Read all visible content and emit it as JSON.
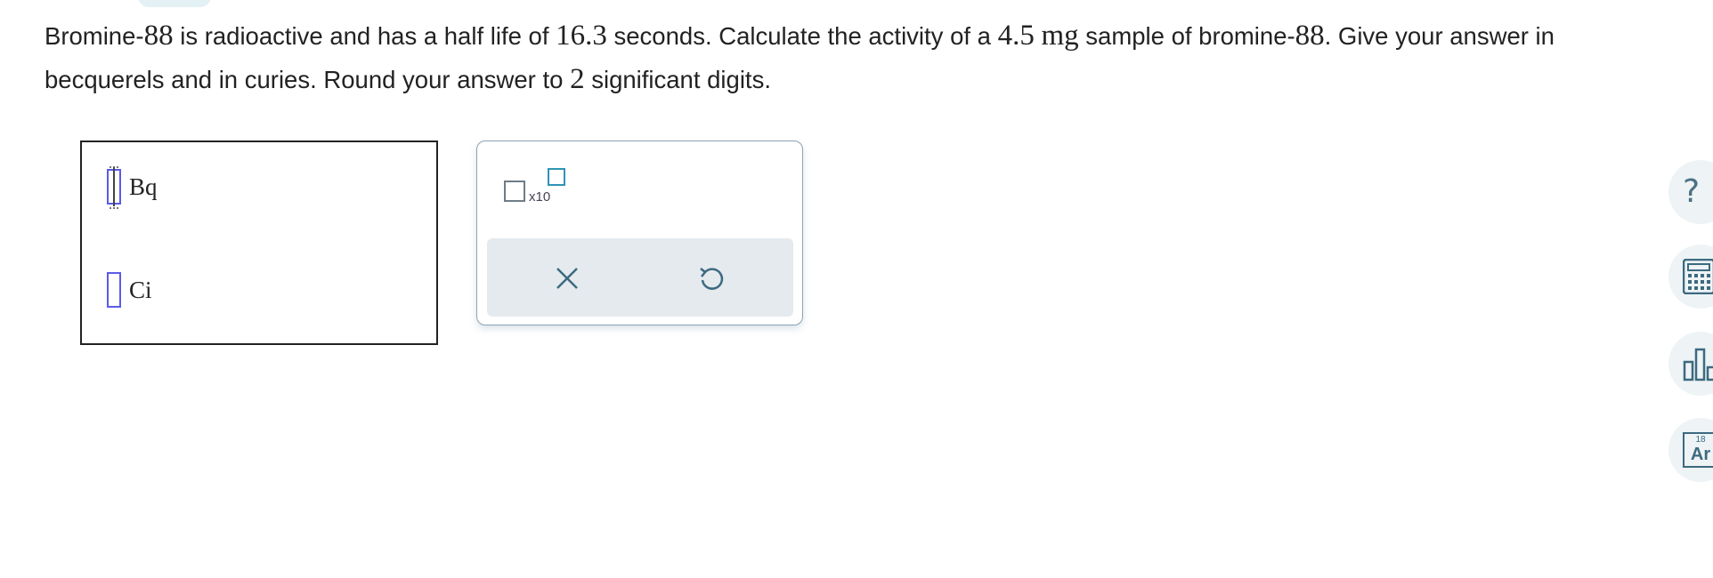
{
  "question": {
    "t1": "Bromine-",
    "m1": "88",
    "t2": " is radioactive and has a half life of ",
    "m2": "16.3",
    "t3": " seconds. Calculate the activity of a ",
    "m3": "4.5",
    "t4": " ",
    "m4": "mg",
    "t5": " sample of bromine-",
    "m5": "88",
    "t6": ". Give your answer in becquerels and in curies. Round your answer to ",
    "m6": "2",
    "t7": " significant digits."
  },
  "answer": {
    "rows": [
      {
        "unit": "Bq",
        "value": ""
      },
      {
        "unit": "Ci",
        "value": ""
      }
    ]
  },
  "tools": {
    "x10_label": "x10",
    "clear_icon": "close-icon",
    "undo_icon": "undo-icon"
  },
  "side": {
    "help_icon": "?",
    "calculator_icon": "calculator-icon",
    "chart_icon": "bar-chart-icon",
    "periodic_table": {
      "number": "18",
      "symbol": "Ar"
    }
  },
  "colors": {
    "slot_border": "#5a5be8",
    "exponent_box": "#2f93b5",
    "action_bar": "#e4eaed",
    "icon": "#3c6a80"
  }
}
